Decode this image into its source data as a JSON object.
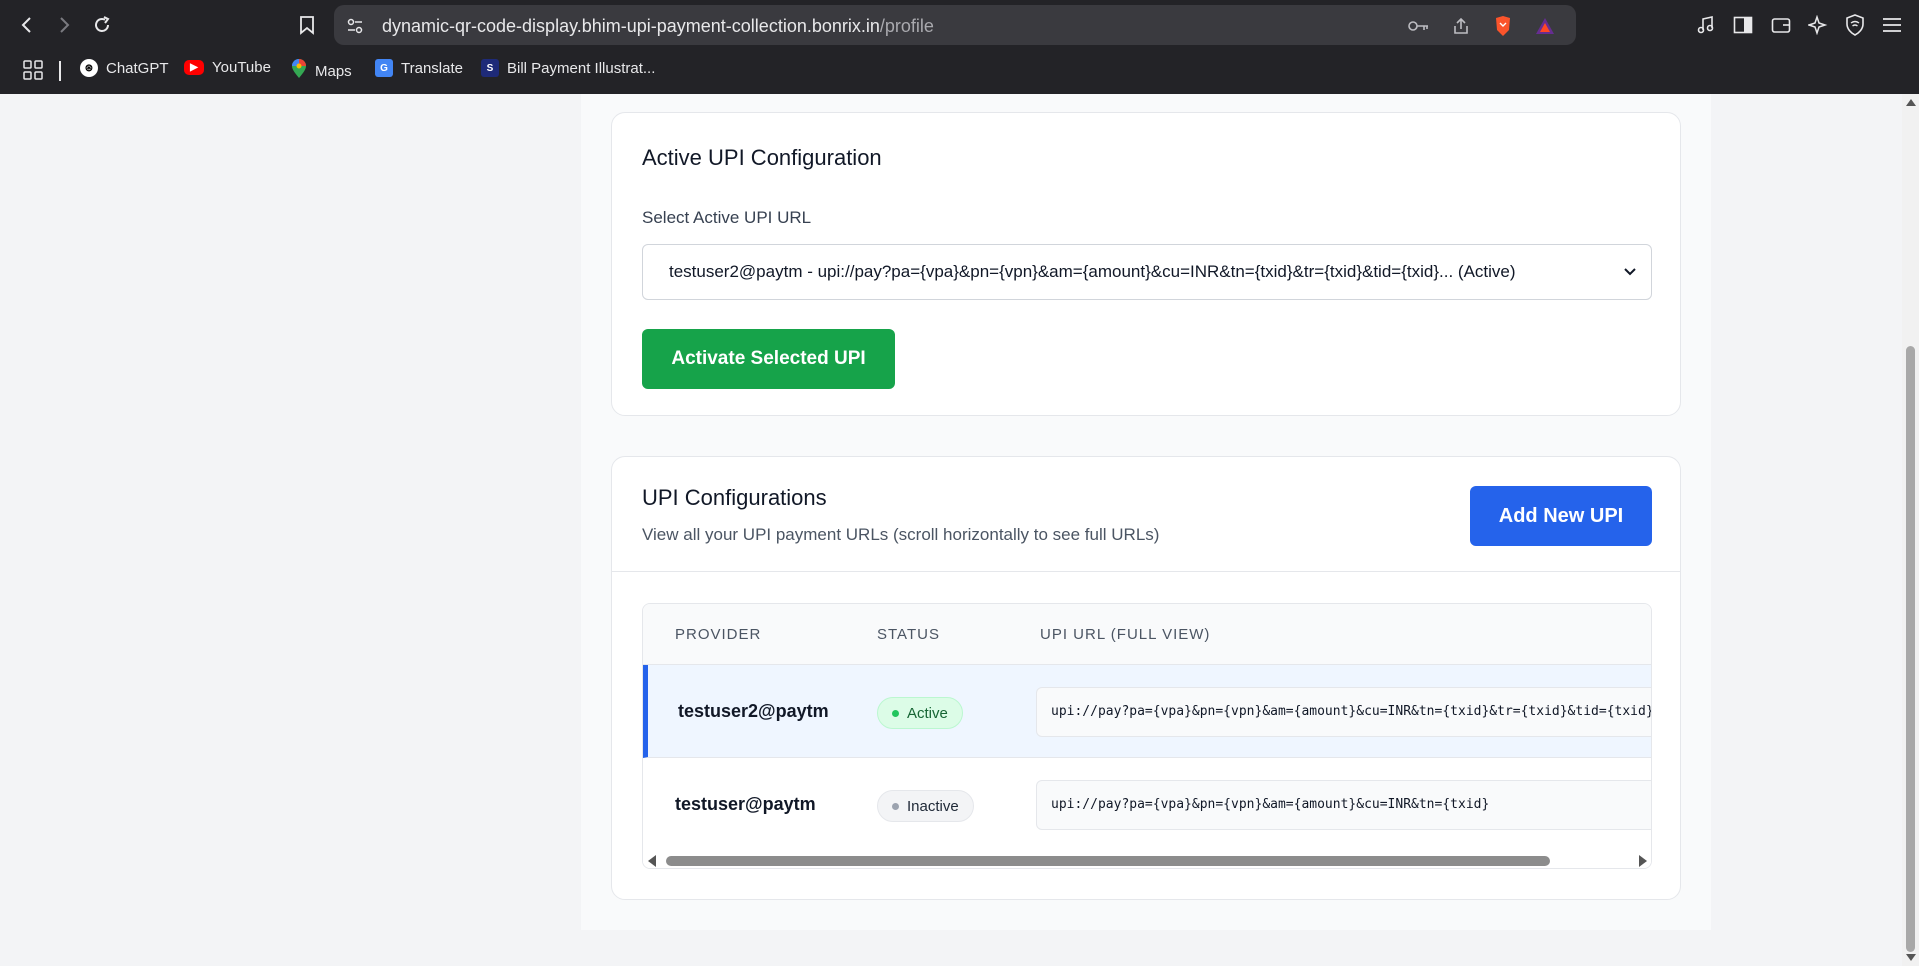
{
  "browser": {
    "url_host": "dynamic-qr-code-display.bhim-upi-payment-collection.bonrix.in",
    "url_path": "/profile",
    "bookmarks": [
      {
        "label": "ChatGPT",
        "icon": "chatgpt-icon"
      },
      {
        "label": "YouTube",
        "icon": "youtube-icon"
      },
      {
        "label": "Maps",
        "icon": "maps-icon"
      },
      {
        "label": "Translate",
        "icon": "translate-icon"
      },
      {
        "label": "Bill Payment Illustrat...",
        "icon": "bill-payment-icon"
      }
    ]
  },
  "active_config": {
    "title": "Active UPI Configuration",
    "select_label": "Select Active UPI URL",
    "selected_value": "testuser2@paytm - upi://pay?pa={vpa}&pn={vpn}&am={amount}&cu=INR&tn={txid}&tr={txid}&tid={txid}... (Active)",
    "activate_button": "Activate Selected UPI"
  },
  "configurations": {
    "title": "UPI Configurations",
    "subtitle": "View all your UPI payment URLs (scroll horizontally to see full URLs)",
    "add_button": "Add New UPI",
    "columns": [
      "PROVIDER",
      "STATUS",
      "UPI URL (FULL VIEW)"
    ],
    "rows": [
      {
        "provider": "testuser2@paytm",
        "status": "Active",
        "url": "upi://pay?pa={vpa}&pn={vpn}&am={amount}&cu=INR&tn={txid}&tr={txid}&tid={txid}"
      },
      {
        "provider": "testuser@paytm",
        "status": "Inactive",
        "url": "upi://pay?pa={vpa}&pn={vpn}&am={amount}&cu=INR&tn={txid}"
      }
    ]
  },
  "colors": {
    "active_green": "#16a34a",
    "primary_blue": "#2563eb",
    "chrome_bg": "#232327"
  }
}
